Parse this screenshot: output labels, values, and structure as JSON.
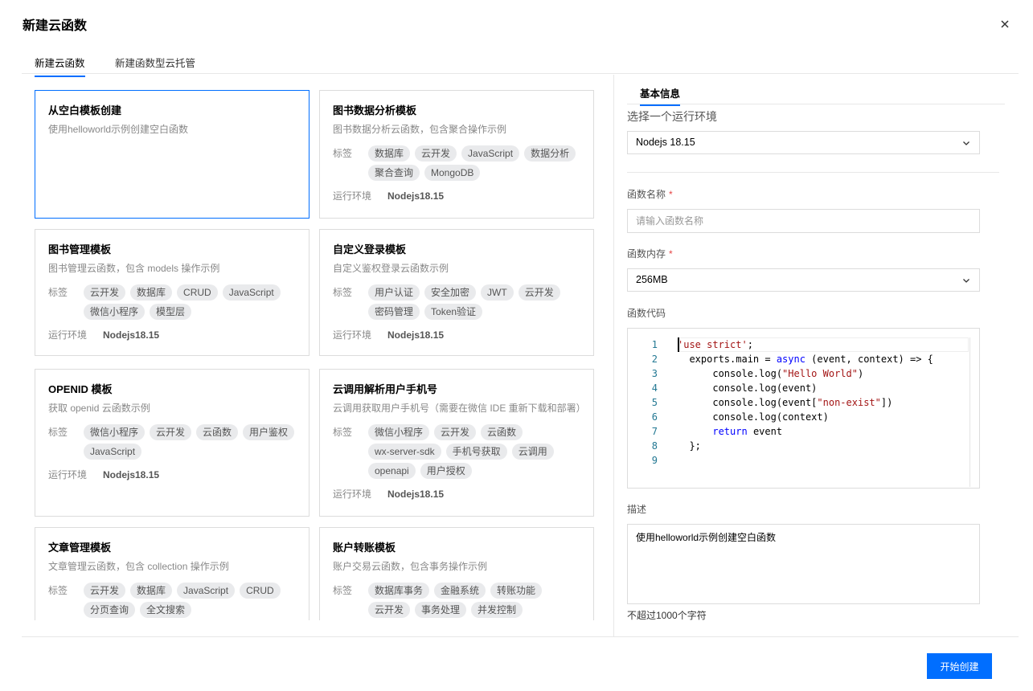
{
  "dialog": {
    "title": "新建云函数"
  },
  "tabs": [
    {
      "label": "新建云函数",
      "active": true
    },
    {
      "label": "新建函数型云托管",
      "active": false
    }
  ],
  "templates": [
    {
      "title": "从空白模板创建",
      "desc": "使用helloworld示例创建空白函数",
      "tags": [],
      "runtime": "",
      "selected": true
    },
    {
      "title": "图书数据分析模板",
      "desc": "图书数据分析云函数，包含聚合操作示例",
      "tags": [
        "数据库",
        "云开发",
        "JavaScript",
        "数据分析",
        "聚合查询",
        "MongoDB"
      ],
      "runtime": "Nodejs18.15"
    },
    {
      "title": "图书管理模板",
      "desc": "图书管理云函数，包含 models 操作示例",
      "tags": [
        "云开发",
        "数据库",
        "CRUD",
        "JavaScript",
        "微信小程序",
        "模型层"
      ],
      "runtime": "Nodejs18.15"
    },
    {
      "title": "自定义登录模板",
      "desc": "自定义鉴权登录云函数示例",
      "tags": [
        "用户认证",
        "安全加密",
        "JWT",
        "云开发",
        "密码管理",
        "Token验证"
      ],
      "runtime": "Nodejs18.15"
    },
    {
      "title": "OPENID 模板",
      "desc": "获取 openid 云函数示例",
      "tags": [
        "微信小程序",
        "云开发",
        "云函数",
        "用户鉴权",
        "JavaScript"
      ],
      "runtime": "Nodejs18.15"
    },
    {
      "title": "云调用解析用户手机号",
      "desc": "云调用获取用户手机号（需要在微信 IDE 重新下载和部署）",
      "tags": [
        "微信小程序",
        "云开发",
        "云函数",
        "wx-server-sdk",
        "手机号获取",
        "云调用",
        "openapi",
        "用户授权"
      ],
      "runtime": "Nodejs18.15"
    },
    {
      "title": "文章管理模板",
      "desc": "文章管理云函数，包含 collection 操作示例",
      "tags": [
        "云开发",
        "数据库",
        "JavaScript",
        "CRUD",
        "分页查询",
        "全文搜索"
      ],
      "runtime": ""
    },
    {
      "title": "账户转账模板",
      "desc": "账户交易云函数，包含事务操作示例",
      "tags": [
        "数据库事务",
        "金融系统",
        "转账功能",
        "云开发",
        "事务处理",
        "并发控制"
      ],
      "runtime": ""
    }
  ],
  "labels": {
    "tags": "标签",
    "runtime": "运行环境"
  },
  "form": {
    "sub_tab": "基本信息",
    "env_label": "选择一个运行环境",
    "env_value": "Nodejs 18.15",
    "name_label": "函数名称",
    "name_placeholder": "请输入函数名称",
    "name_value": "",
    "required_mark": "*",
    "memory_label": "函数内存",
    "memory_value": "256MB",
    "code_label": "函数代码",
    "code_lines": [
      {
        "n": "1",
        "segs": [
          {
            "t": "'use strict'",
            "c": "str"
          },
          {
            "t": ";",
            "c": ""
          }
        ]
      },
      {
        "n": "2",
        "segs": [
          {
            "t": "  exports.main = ",
            "c": ""
          },
          {
            "t": "async",
            "c": "kw"
          },
          {
            "t": " (event, context) => {",
            "c": ""
          }
        ]
      },
      {
        "n": "3",
        "segs": [
          {
            "t": "      console.log(",
            "c": ""
          },
          {
            "t": "\"Hello World\"",
            "c": "str"
          },
          {
            "t": ")",
            "c": ""
          }
        ]
      },
      {
        "n": "4",
        "segs": [
          {
            "t": "      console.log(event)",
            "c": ""
          }
        ]
      },
      {
        "n": "5",
        "segs": [
          {
            "t": "      console.log(event[",
            "c": ""
          },
          {
            "t": "\"non-exist\"",
            "c": "str"
          },
          {
            "t": "])",
            "c": ""
          }
        ]
      },
      {
        "n": "6",
        "segs": [
          {
            "t": "      console.log(context)",
            "c": ""
          }
        ]
      },
      {
        "n": "7",
        "segs": [
          {
            "t": "      ",
            "c": ""
          },
          {
            "t": "return",
            "c": "kw"
          },
          {
            "t": " event",
            "c": ""
          }
        ]
      },
      {
        "n": "8",
        "segs": [
          {
            "t": "  };",
            "c": ""
          }
        ]
      },
      {
        "n": "9",
        "segs": []
      }
    ],
    "desc_label": "描述",
    "desc_value": "使用helloworld示例创建空白函数",
    "desc_hint": "不超过1000个字符"
  },
  "footer": {
    "create_label": "开始创建"
  },
  "icons": {
    "close": "close-icon",
    "dropdown": "chevron-down-icon"
  },
  "colors": {
    "accent": "#006eff",
    "required": "#e54545"
  }
}
